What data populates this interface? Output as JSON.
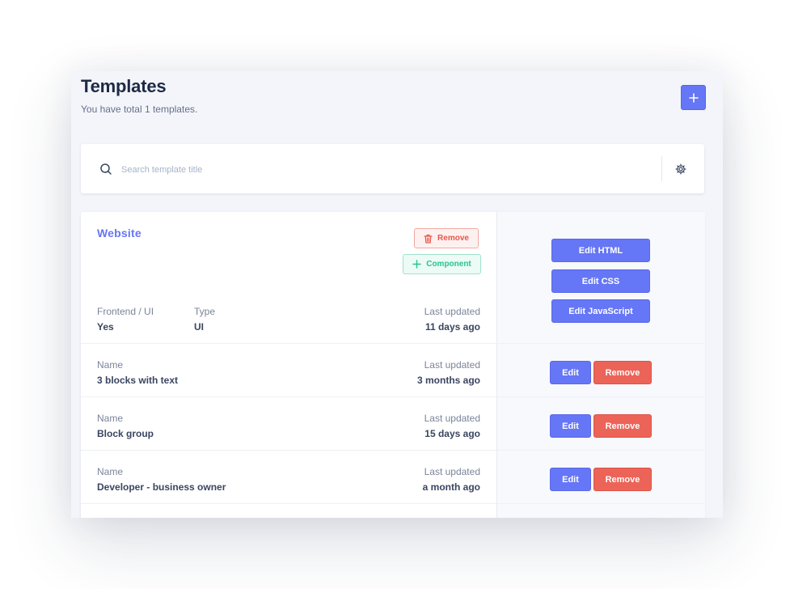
{
  "header": {
    "title": "Templates",
    "subtitle": "You have total 1 templates."
  },
  "search": {
    "placeholder": "Search template title",
    "value": ""
  },
  "template_group": {
    "title": "Website",
    "remove_label": "Remove",
    "component_label": "Component",
    "meta": {
      "frontend_label": "Frontend / UI",
      "frontend_value": "Yes",
      "type_label": "Type",
      "type_value": "UI",
      "updated_label": "Last updated",
      "updated_value": "11 days ago"
    },
    "actions": {
      "edit_html": "Edit HTML",
      "edit_css": "Edit CSS",
      "edit_js": "Edit JavaScript"
    }
  },
  "components": [
    {
      "name_label": "Name",
      "name": "3 blocks with text",
      "updated_label": "Last updated",
      "updated": "3 months ago",
      "edit_label": "Edit",
      "remove_label": "Remove"
    },
    {
      "name_label": "Name",
      "name": "Block group",
      "updated_label": "Last updated",
      "updated": "15 days ago",
      "edit_label": "Edit",
      "remove_label": "Remove"
    },
    {
      "name_label": "Name",
      "name": "Developer - business owner",
      "updated_label": "Last updated",
      "updated": "a month ago",
      "edit_label": "Edit",
      "remove_label": "Remove"
    }
  ],
  "icons": {
    "add": "plus-icon",
    "search": "search-icon",
    "settings": "gear-icon",
    "remove": "trash-icon",
    "component": "plus-icon"
  },
  "colors": {
    "accent": "#6576f6",
    "danger": "#ec6358",
    "success": "#26c48f",
    "title": "#1e2a45"
  }
}
